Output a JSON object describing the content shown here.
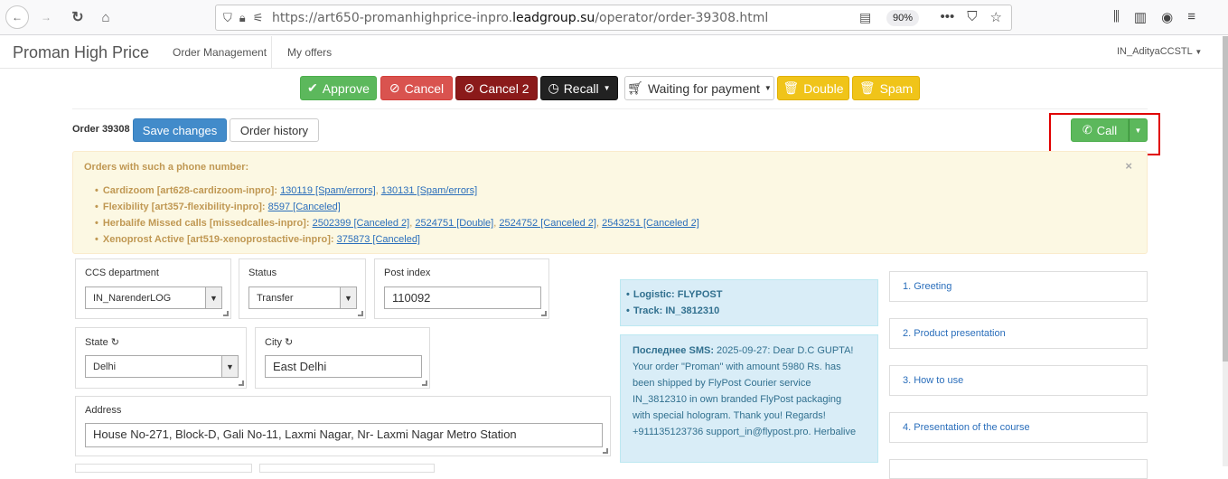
{
  "browser": {
    "url_prefix": "https://art650-promanhighprice-inpro.",
    "url_domain": "leadgroup.su",
    "url_path": "/operator/order-39308.html",
    "zoom": "90%"
  },
  "navbar": {
    "brand": "Proman High Price",
    "links": [
      "Order Management",
      "My offers"
    ],
    "user": "IN_AdityaCCSTL"
  },
  "actions": {
    "approve": "Approve",
    "cancel": "Cancel",
    "cancel2": "Cancel 2",
    "recall": "Recall",
    "waiting": "Waiting for payment",
    "double": "Double",
    "spam": "Spam"
  },
  "order": {
    "label": "Order 39308",
    "save": "Save changes",
    "history": "Order history",
    "call": "Call"
  },
  "phone_orders": {
    "title": "Orders with such a phone number:",
    "items": [
      {
        "name": "Cardizoom [art628-cardizoom-inpro]",
        "links": [
          "130119 [Spam/errors]",
          "130131 [Spam/errors]"
        ]
      },
      {
        "name": "Flexibility [art357-flexibility-inpro]",
        "links": [
          "8597 [Canceled]"
        ]
      },
      {
        "name": "Herbalife Missed calls [missedcalles-inpro]",
        "links": [
          "2502399 [Canceled 2]",
          "2524751 [Double]",
          "2524752 [Canceled 2]",
          "2543251 [Canceled 2]"
        ]
      },
      {
        "name": "Xenoprost Active [art519-xenoprostactive-inpro]",
        "links": [
          "375873 [Canceled]"
        ]
      }
    ]
  },
  "form": {
    "ccs_label": "CCS department",
    "ccs_value": "IN_NarenderLOG",
    "status_label": "Status",
    "status_value": "Transfer",
    "post_label": "Post index",
    "post_value": "110092",
    "state_label": "State",
    "state_value": "Delhi",
    "city_label": "City",
    "city_value": "East Delhi",
    "address_label": "Address",
    "address_value": "House No-271, Block-D, Gali No-11, Laxmi Nagar, Nr- Laxmi Nagar Metro Station"
  },
  "logistics": {
    "items": [
      "Logistic: FLYPOST",
      "Track: IN_3812310"
    ]
  },
  "sms": {
    "label": "Последнее SMS:",
    "text": "2025-09-27: Dear D.C GUPTA! Your order \"Proman\" with amount 5980 Rs. has been shipped by FlyPost Courier service IN_3812310 in own branded FlyPost packaging with special hologram. Thank you! Regards! +911135123736 support_in@flypost.pro. Herbalive"
  },
  "script_steps": [
    "1. Greeting",
    "2. Product presentation",
    "3. How to use",
    "4. Presentation of the course"
  ]
}
